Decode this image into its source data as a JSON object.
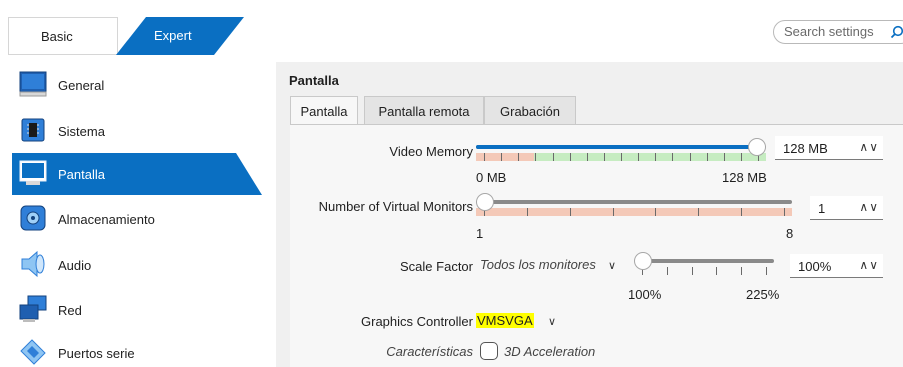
{
  "mode_switch": {
    "basic_label": "Basic",
    "expert_label": "Expert",
    "selected": "Expert"
  },
  "search": {
    "placeholder": "Search settings"
  },
  "sidebar": {
    "items": [
      {
        "label": "General",
        "icon": "monitor-icon"
      },
      {
        "label": "Sistema",
        "icon": "chip-icon"
      },
      {
        "label": "Pantalla",
        "icon": "display-icon",
        "active": true
      },
      {
        "label": "Almacenamiento",
        "icon": "disk-icon"
      },
      {
        "label": "Audio",
        "icon": "speaker-icon"
      },
      {
        "label": "Red",
        "icon": "network-icon"
      },
      {
        "label": "Puertos serie",
        "icon": "serial-port-icon"
      }
    ]
  },
  "panel": {
    "title": "Pantalla",
    "tabs": [
      {
        "label": "Pantalla",
        "active": true
      },
      {
        "label": "Pantalla remota"
      },
      {
        "label": "Grabación"
      }
    ]
  },
  "video_memory": {
    "label": "Video Memory",
    "value": "128 MB",
    "min_label": "0 MB",
    "max_label": "128 MB",
    "fraction": 1.0
  },
  "virtual_monitors": {
    "label": "Number of Virtual Monitors",
    "value": "1",
    "min_label": "1",
    "max_label": "8",
    "fraction": 0.0
  },
  "scale_factor": {
    "label": "Scale Factor",
    "monitor_select": "Todos los monitores",
    "value": "100%",
    "min_label": "100%",
    "max_label": "225%",
    "fraction": 0.0
  },
  "graphics_controller": {
    "label": "Graphics Controller",
    "value": "VMSVGA"
  },
  "features": {
    "label": "Características",
    "acceleration_label": "3D Acceleration",
    "acceleration_checked": false
  },
  "colors": {
    "accent": "#0a6fc2",
    "panel_bg": "#f0f0f0",
    "highlight": "#ffff00"
  }
}
